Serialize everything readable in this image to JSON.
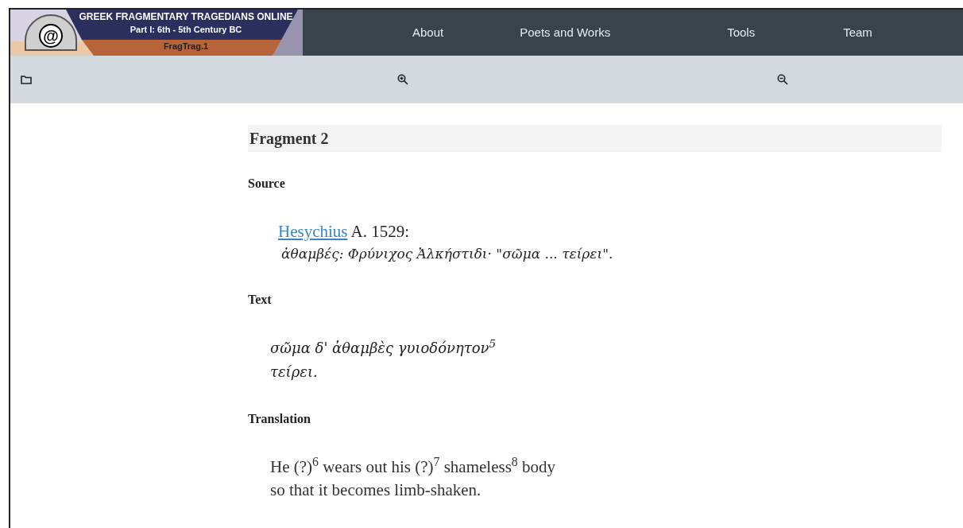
{
  "banner": {
    "logo_mark": "@",
    "title": "GREEK FRAGMENTARY TRAGEDIANS ONLINE",
    "subtitle": "Part I: 6th - 5th Century BC",
    "edition": "FragTrag.1"
  },
  "nav": [
    "About",
    "Poets and Works",
    "Tools",
    "Team"
  ],
  "fragment": {
    "heading": "Fragment 2",
    "sections": [
      {
        "kind": "source",
        "title": "Source",
        "link": "Hesychius",
        "citation": " A. 1529:",
        "quote": "ἀθαμβές: Φρύνιχος Ἀλκήστιδι· \"σῶμα ... τείρει\"."
      },
      {
        "kind": "text",
        "title": "Text",
        "lines": [
          "σῶμα δ' ἀθαμβὲς γυιοδόνητον$^{5}$",
          "τείρει."
        ]
      },
      {
        "kind": "translation",
        "title": "Translation",
        "lines": [
          "He (?)$^{6}$ wears out his (?)$^{7}$ shameless$^{8}$ body",
          "so that it becomes limb-shaken."
        ]
      }
    ]
  }
}
